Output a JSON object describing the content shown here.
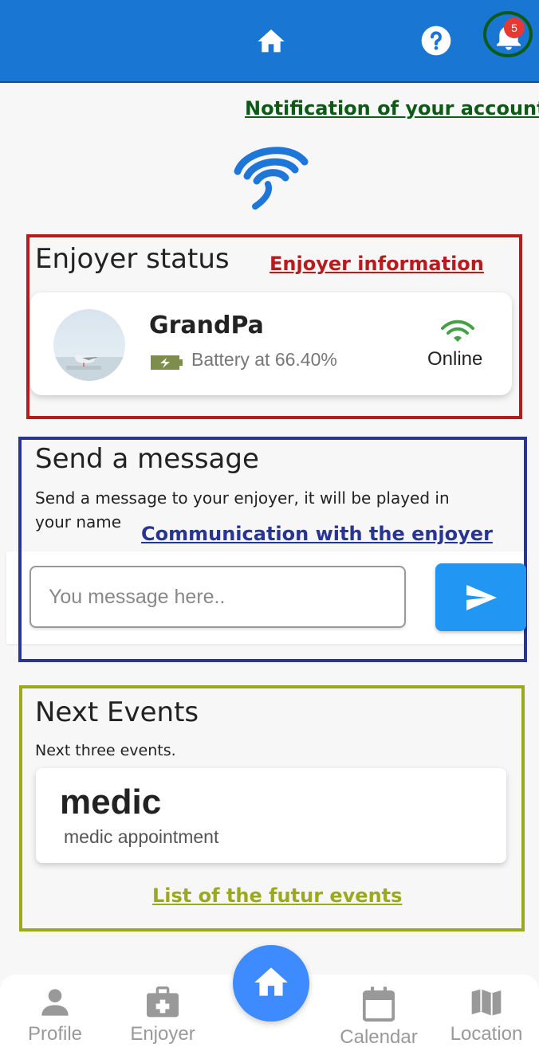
{
  "header": {
    "home_icon": "home-icon",
    "help_icon": "help-icon",
    "notification_icon": "bell-icon",
    "notification_count": "5",
    "color": "#1976d2"
  },
  "annotations": {
    "notification": "Notification of your account",
    "enjoyer_info": "Enjoyer information",
    "communication": "Communication with the enjoyer",
    "events": "List of the futur events"
  },
  "enjoyer": {
    "section_title": "Enjoyer status",
    "name": "GrandPa",
    "battery": "Battery at 66.40%",
    "status": "Online"
  },
  "message": {
    "section_title": "Send a message",
    "description": "Send a message to your enjoyer, it will be played in your name",
    "placeholder": "You message here..",
    "send_icon": "send-icon"
  },
  "events": {
    "section_title": "Next Events",
    "description": "Next three events.",
    "items": [
      {
        "title": "medic",
        "subtitle": "medic appointment"
      }
    ]
  },
  "nav": {
    "items": [
      {
        "label": "Profile",
        "icon": "person-icon"
      },
      {
        "label": "Enjoyer",
        "icon": "medkit-icon"
      },
      {
        "label": "",
        "icon": "home-icon"
      },
      {
        "label": "Calendar",
        "icon": "calendar-icon"
      },
      {
        "label": "Location",
        "icon": "map-icon"
      }
    ]
  }
}
